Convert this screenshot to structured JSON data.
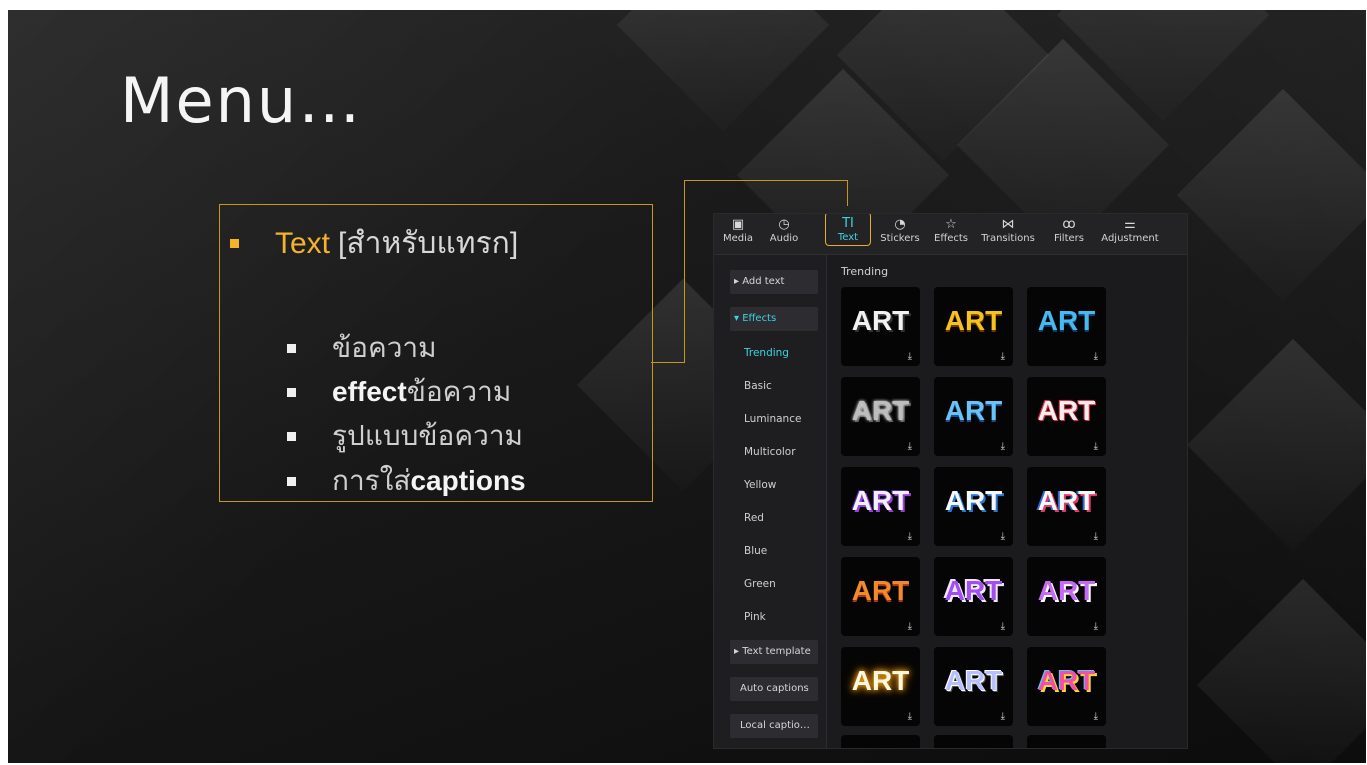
{
  "slide": {
    "title": "Menu…",
    "bullet_main": {
      "accent": "Text",
      "rest": "[สำหรับแทรก]"
    },
    "sub_bullets": [
      {
        "bold": "",
        "thin": "ข้อความ"
      },
      {
        "bold": "effect",
        "thin": " ข้อความ"
      },
      {
        "bold": "",
        "thin": "รูปแบบข้อความ"
      },
      {
        "bold": "captions",
        "thin": "การใส่ "
      }
    ]
  },
  "app": {
    "toolbar": [
      {
        "label": "Media",
        "icon": "media-icon",
        "glyph": "▣"
      },
      {
        "label": "Audio",
        "icon": "audio-icon",
        "glyph": "◷"
      },
      {
        "label": "Text",
        "icon": "text-icon",
        "glyph": "TI"
      },
      {
        "label": "Stickers",
        "icon": "stickers-icon",
        "glyph": "◔"
      },
      {
        "label": "Effects",
        "icon": "effects-icon",
        "glyph": "☆"
      },
      {
        "label": "Transitions",
        "icon": "transitions-icon",
        "glyph": "⋈"
      },
      {
        "label": "Filters",
        "icon": "filters-icon",
        "glyph": "ꝏ"
      },
      {
        "label": "Adjustment",
        "icon": "adjustment-icon",
        "glyph": "⚌"
      }
    ],
    "sidebar": {
      "add_text": "Add text",
      "effects": "Effects",
      "categories": [
        "Trending",
        "Basic",
        "Luminance",
        "Multicolor",
        "Yellow",
        "Red",
        "Blue",
        "Green",
        "Pink"
      ],
      "text_template": "Text template",
      "auto_captions": "Auto captions",
      "local_captions": "Local captio…"
    },
    "section_label": "Trending",
    "tile_text": "ART",
    "download_glyph": "⤓",
    "colors": {
      "accent": "#3fd2e0",
      "highlight": "#e8b02a",
      "bullet_accent": "#f5b32a"
    }
  }
}
